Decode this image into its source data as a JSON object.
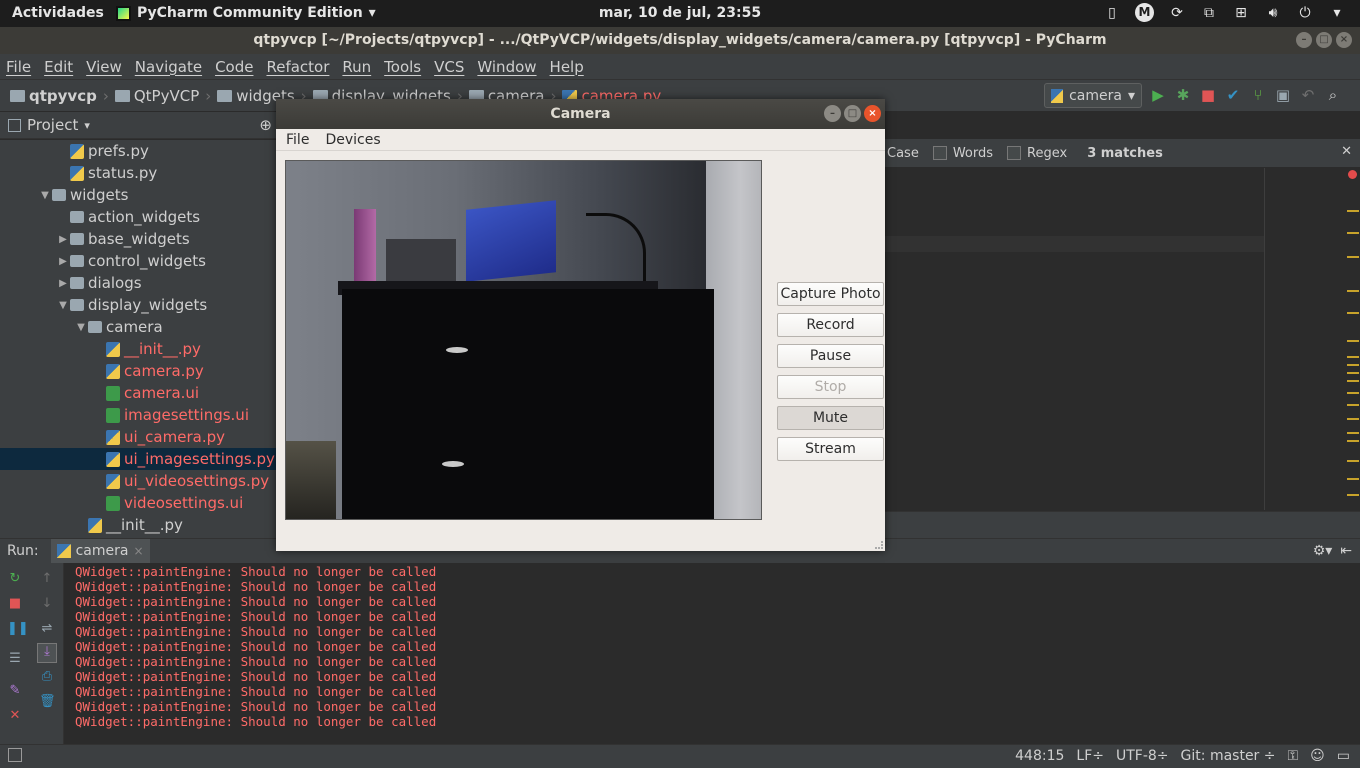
{
  "topbar": {
    "activities": "Actividades",
    "app_name": "PyCharm Community Edition",
    "clock": "mar, 10 de jul, 23:55",
    "tray_badge": "M"
  },
  "window": {
    "title": "qtpyvcp [~/Projects/qtpyvcp] - .../QtPyVCP/widgets/display_widgets/camera/camera.py [qtpyvcp] - PyCharm"
  },
  "menu": [
    "File",
    "Edit",
    "View",
    "Navigate",
    "Code",
    "Refactor",
    "Run",
    "Tools",
    "VCS",
    "Window",
    "Help"
  ],
  "breadcrumbs": [
    "qtpyvcp",
    "QtPyVCP",
    "widgets",
    "display_widgets",
    "camera",
    "camera.py"
  ],
  "run_config": "camera",
  "project": {
    "header": "Project",
    "tree": [
      {
        "label": "prefs.py",
        "icon": "python-file-icon",
        "indent": 4,
        "red": false,
        "arrow": ""
      },
      {
        "label": "status.py",
        "icon": "python-file-icon",
        "indent": 4,
        "red": false,
        "arrow": ""
      },
      {
        "label": "widgets",
        "icon": "folder-icon",
        "indent": 3,
        "red": false,
        "arrow": "▼"
      },
      {
        "label": "action_widgets",
        "icon": "folder-icon",
        "indent": 4,
        "red": false,
        "arrow": ""
      },
      {
        "label": "base_widgets",
        "icon": "folder-icon",
        "indent": 4,
        "red": false,
        "arrow": "▶"
      },
      {
        "label": "control_widgets",
        "icon": "folder-icon",
        "indent": 4,
        "red": false,
        "arrow": "▶"
      },
      {
        "label": "dialogs",
        "icon": "folder-icon",
        "indent": 4,
        "red": false,
        "arrow": "▶"
      },
      {
        "label": "display_widgets",
        "icon": "folder-icon",
        "indent": 4,
        "red": false,
        "arrow": "▼"
      },
      {
        "label": "camera",
        "icon": "folder-icon",
        "indent": 5,
        "red": false,
        "arrow": "▼"
      },
      {
        "label": "__init__.py",
        "icon": "python-file-icon",
        "indent": 6,
        "red": true,
        "arrow": ""
      },
      {
        "label": "camera.py",
        "icon": "python-file-icon",
        "indent": 6,
        "red": true,
        "arrow": ""
      },
      {
        "label": "camera.ui",
        "icon": "qt-ui-file-icon",
        "indent": 6,
        "red": true,
        "arrow": ""
      },
      {
        "label": "imagesettings.ui",
        "icon": "qt-ui-file-icon",
        "indent": 6,
        "red": true,
        "arrow": ""
      },
      {
        "label": "ui_camera.py",
        "icon": "python-file-icon",
        "indent": 6,
        "red": true,
        "arrow": ""
      },
      {
        "label": "ui_imagesettings.py",
        "icon": "python-file-icon",
        "indent": 6,
        "red": true,
        "arrow": "",
        "selected": true
      },
      {
        "label": "ui_videosettings.py",
        "icon": "python-file-icon",
        "indent": 6,
        "red": true,
        "arrow": ""
      },
      {
        "label": "videosettings.ui",
        "icon": "qt-ui-file-icon",
        "indent": 6,
        "red": true,
        "arrow": ""
      },
      {
        "label": "__init__.py",
        "icon": "python-file-icon",
        "indent": 5,
        "red": false,
        "arrow": ""
      }
    ]
  },
  "findbar": {
    "case_label": "Case",
    "words_label": "Words",
    "regex_label": "Regex",
    "matches": "3 matches"
  },
  "run_panel": {
    "label": "Run:",
    "tab": "camera",
    "console_lines": [
      "QWidget::paintEngine: Should no longer be called",
      "QWidget::paintEngine: Should no longer be called",
      "QWidget::paintEngine: Should no longer be called",
      "QWidget::paintEngine: Should no longer be called",
      "QWidget::paintEngine: Should no longer be called",
      "QWidget::paintEngine: Should no longer be called",
      "QWidget::paintEngine: Should no longer be called",
      "QWidget::paintEngine: Should no longer be called",
      "QWidget::paintEngine: Should no longer be called",
      "QWidget::paintEngine: Should no longer be called",
      "QWidget::paintEngine: Should no longer be called"
    ]
  },
  "statusbar": {
    "position": "448:15",
    "line_sep": "LF÷",
    "encoding": "UTF-8÷",
    "git": "Git: master ÷"
  },
  "camera_dialog": {
    "title": "Camera",
    "menu": [
      "File",
      "Devices"
    ],
    "buttons": [
      {
        "label": "Capture Photo",
        "state": "normal"
      },
      {
        "label": "Record",
        "state": "normal"
      },
      {
        "label": "Pause",
        "state": "normal"
      },
      {
        "label": "Stop",
        "state": "disabled"
      },
      {
        "label": "Mute",
        "state": "pressed"
      },
      {
        "label": "Stream",
        "state": "normal"
      }
    ]
  }
}
